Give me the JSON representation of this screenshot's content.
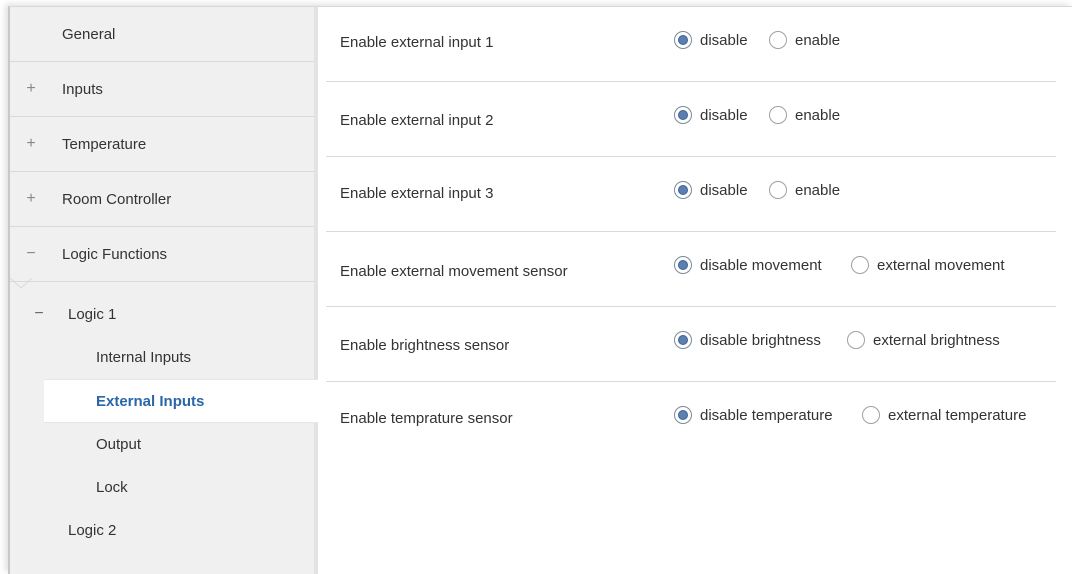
{
  "sidebar": {
    "top_items": [
      {
        "symbol": "",
        "label": "General"
      },
      {
        "symbol": "+",
        "label": "Inputs"
      },
      {
        "symbol": "+",
        "label": "Temperature"
      },
      {
        "symbol": "+",
        "label": "Room Controller"
      },
      {
        "symbol": "−",
        "label": "Logic Functions"
      }
    ],
    "logic1": {
      "symbol": "−",
      "label": "Logic 1"
    },
    "logic1_children": [
      "Internal Inputs",
      "External Inputs",
      "Output",
      "Lock"
    ],
    "active_child": "External Inputs",
    "logic2": {
      "label": "Logic 2"
    }
  },
  "settings": [
    {
      "label": "Enable external input 1",
      "option_off": "disable",
      "option_on": "enable",
      "selected": "disable"
    },
    {
      "label": "Enable external input 2",
      "option_off": "disable",
      "option_on": "enable",
      "selected": "disable"
    },
    {
      "label": "Enable external input 3",
      "option_off": "disable",
      "option_on": "enable",
      "selected": "disable"
    },
    {
      "label": "Enable external movement sensor",
      "option_off": "disable movement",
      "option_on": "external movement",
      "selected": "disable movement"
    },
    {
      "label": "Enable brightness sensor",
      "option_off": "disable brightness",
      "option_on": "external brightness",
      "selected": "disable brightness"
    },
    {
      "label": "Enable temprature sensor",
      "option_off": "disable temperature",
      "option_on": "external temperature",
      "selected": "disable temperature"
    }
  ],
  "colors": {
    "active": "#2a67a8",
    "radio_dot": "#5a7fb0"
  }
}
